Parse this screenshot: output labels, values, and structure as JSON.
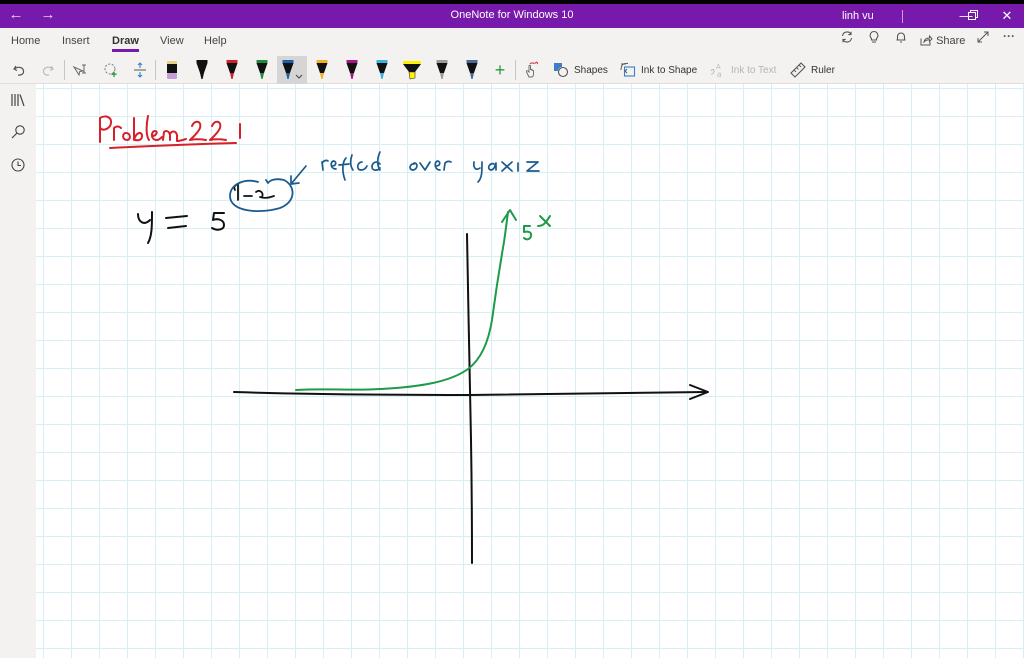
{
  "titlebar": {
    "title": "OneNote for Windows 10",
    "user": "linh vu",
    "back_icon": "arrow-left-icon",
    "forward_icon": "arrow-right-icon",
    "minimize": "—",
    "restore": "❐",
    "close": "✕",
    "back_glyph": "←",
    "forward_glyph": "→"
  },
  "ribbon": {
    "tabs": [
      {
        "label": "Home"
      },
      {
        "label": "Insert"
      },
      {
        "label": "Draw",
        "active": true
      },
      {
        "label": "View"
      },
      {
        "label": "Help"
      }
    ],
    "right_icons": {
      "sync": "⟳",
      "lightbulb": "💡",
      "bell": "🔔",
      "expand": "⤢",
      "more": "···"
    },
    "share_label": "Share",
    "tools": {
      "shapes_label": "Shapes",
      "ink_to_shape_label": "Ink to Shape",
      "ink_to_text_label": "Ink to Text",
      "ruler_label": "Ruler",
      "add_pen": "+"
    },
    "pens": [
      {
        "name": "eraser",
        "color": "#c89bd8",
        "top": "#e8d08a"
      },
      {
        "name": "pen-black",
        "color": "#111111"
      },
      {
        "name": "pen-red",
        "color": "#d0202a"
      },
      {
        "name": "pen-green",
        "color": "#1e8a3e"
      },
      {
        "name": "pen-blue",
        "color": "#1a5fa8",
        "selected": true
      },
      {
        "name": "pen-yellow",
        "color": "#f0b020"
      },
      {
        "name": "pen-magenta",
        "color": "#a8168a"
      },
      {
        "name": "pen-cyan",
        "color": "#3ab0e0"
      },
      {
        "name": "highlighter-yellow",
        "color": "#fff200"
      },
      {
        "name": "pen-galaxy",
        "color": "#9a9a9a"
      },
      {
        "name": "pen-ocean",
        "color": "#4a6a9a"
      }
    ]
  },
  "sidebar": {
    "items": [
      {
        "name": "notebooks",
        "icon": "notebooks-icon"
      },
      {
        "name": "search",
        "icon": "search-icon"
      },
      {
        "name": "recent",
        "icon": "clock-icon"
      }
    ]
  },
  "page": {
    "ink": {
      "heading": "Problem 22",
      "equation": "y = 5^(1-x)",
      "note": "reflect over y axis",
      "curve_label": "5^x",
      "heading_color": "#d6202a",
      "equation_color": "#111111",
      "note_color": "#1a5a8e",
      "curve_color": "#1e9a4a"
    }
  }
}
